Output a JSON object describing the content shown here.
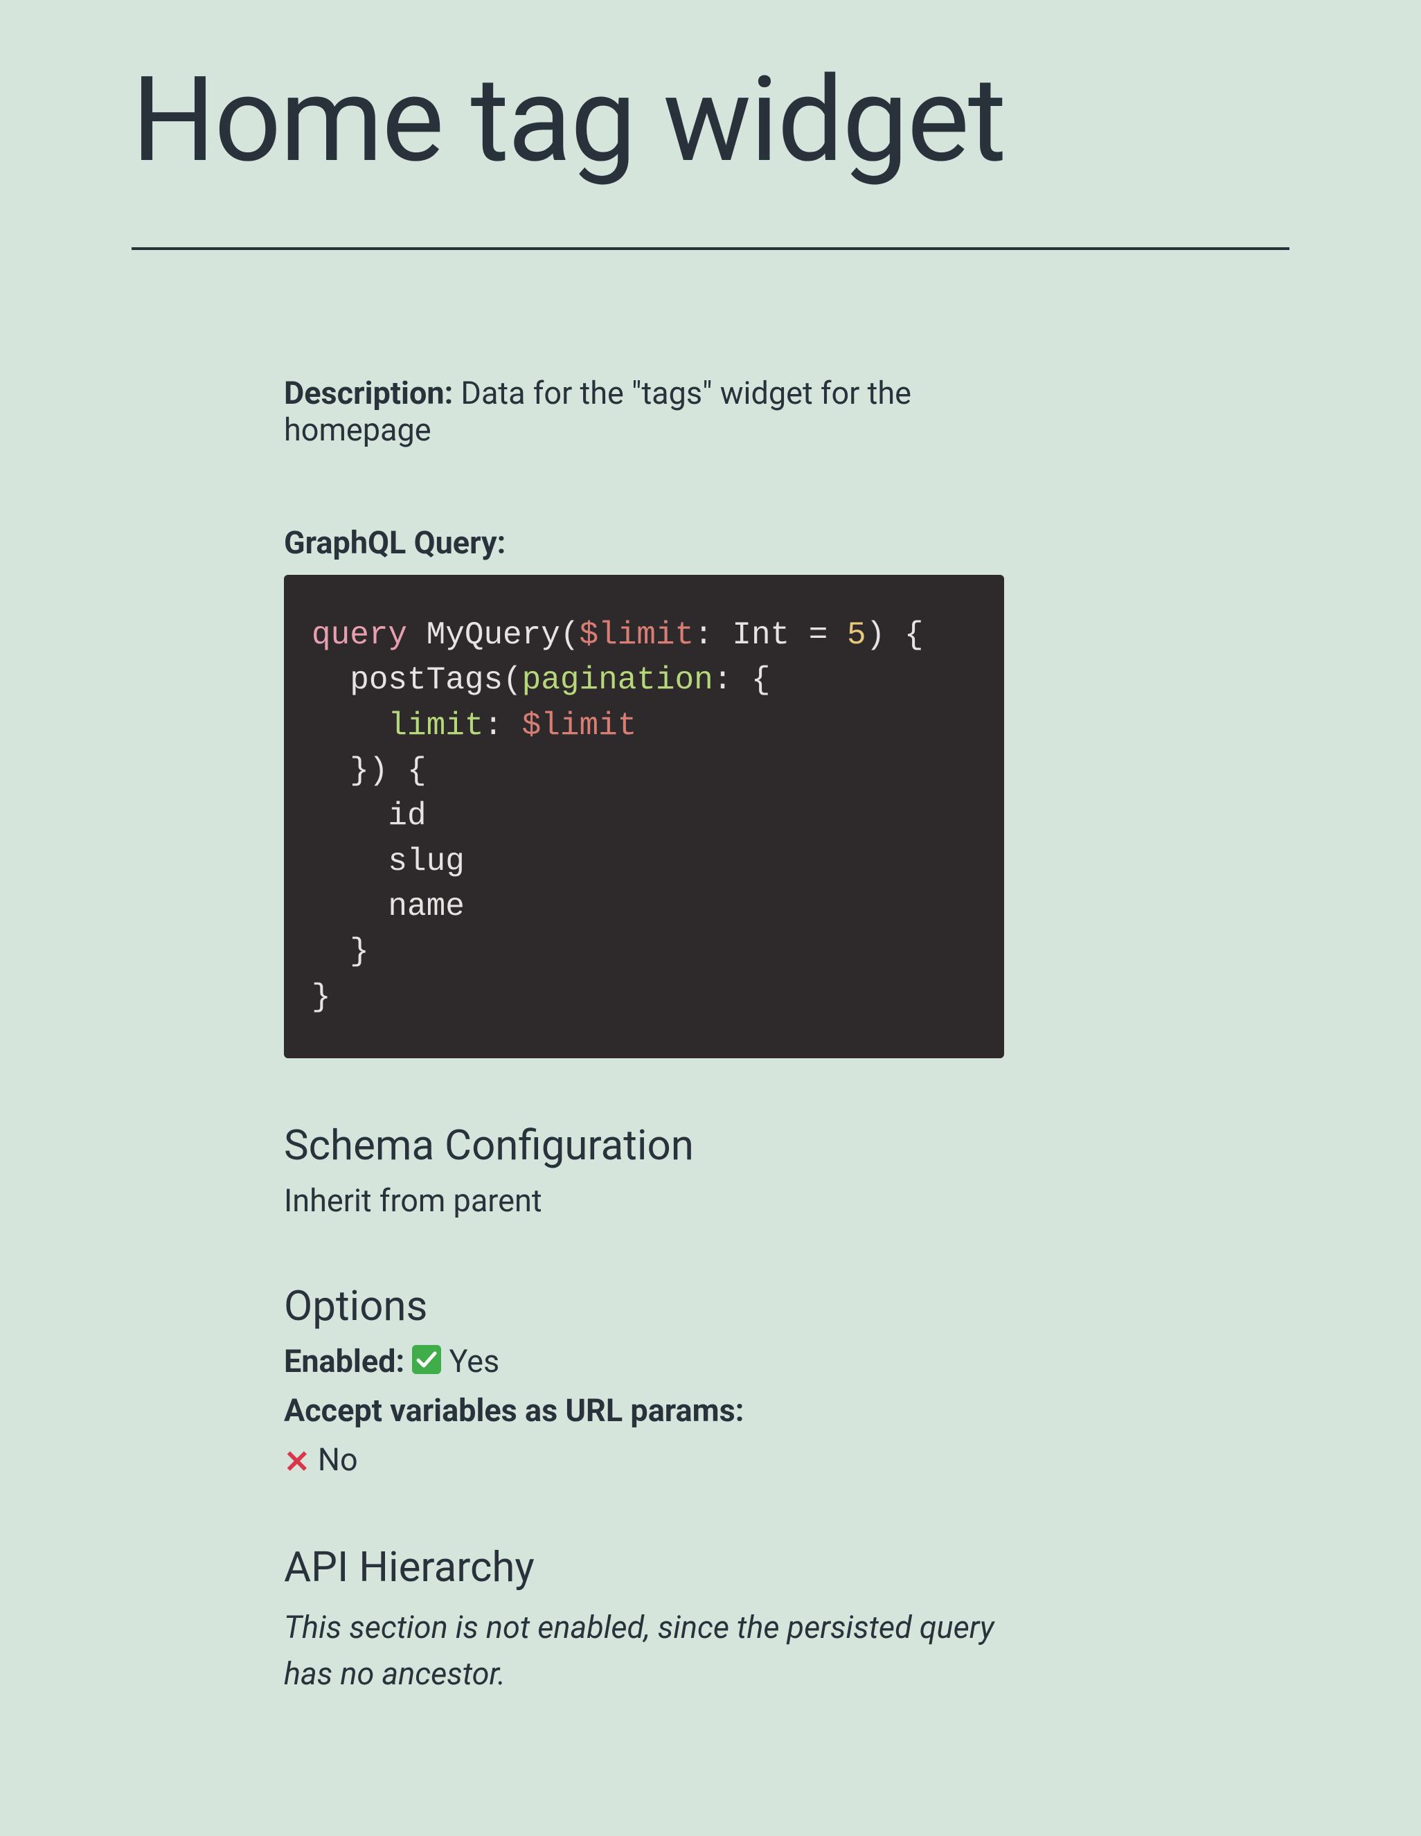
{
  "title": "Home tag widget",
  "description": {
    "label": "Description:",
    "text": "Data for the \"tags\" widget for the homepage"
  },
  "graphql": {
    "label": "GraphQL Query:",
    "code": {
      "kw_query": "query",
      "name": "MyQuery",
      "var_limit": "$limit",
      "type_int": "Int",
      "eq": "=",
      "num_five": "5",
      "postTags": "postTags",
      "arg_pagination": "pagination",
      "arg_limit": "limit",
      "field_id": "id",
      "field_slug": "slug",
      "field_name": "name"
    }
  },
  "schema": {
    "heading": "Schema Configuration",
    "text": "Inherit from parent"
  },
  "options": {
    "heading": "Options",
    "enabled_label": "Enabled:",
    "enabled_value": "Yes",
    "accept_label": "Accept variables as URL params:",
    "accept_value": "No"
  },
  "api_hierarchy": {
    "heading": "API Hierarchy",
    "note": "This section is not enabled, since the persisted query has no ancestor."
  }
}
